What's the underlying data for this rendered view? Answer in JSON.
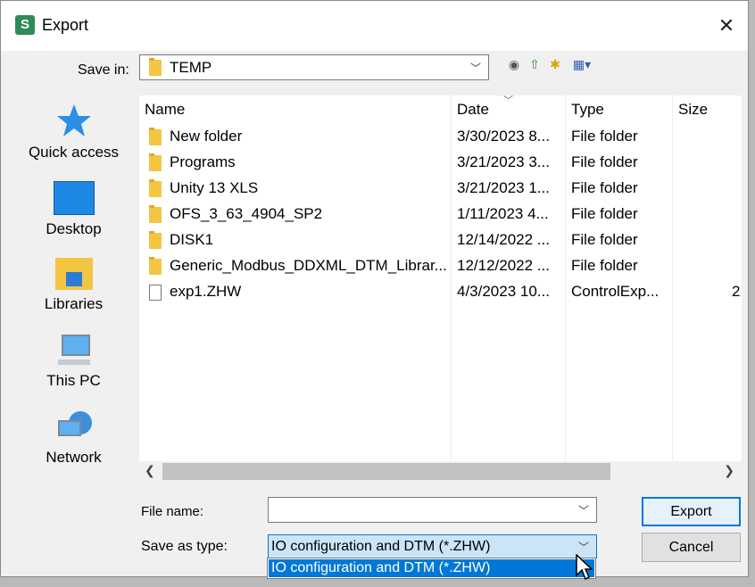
{
  "window": {
    "title": "Export",
    "close_glyph": "✕"
  },
  "save_in": {
    "label": "Save in:",
    "value": "TEMP"
  },
  "places": [
    {
      "label": "Quick access",
      "icon": "star-icon"
    },
    {
      "label": "Desktop",
      "icon": "desktop-icon"
    },
    {
      "label": "Libraries",
      "icon": "libraries-icon"
    },
    {
      "label": "This PC",
      "icon": "computer-icon"
    },
    {
      "label": "Network",
      "icon": "network-icon"
    }
  ],
  "columns": {
    "name": "Name",
    "date": "Date",
    "type": "Type",
    "size": "Size"
  },
  "files": [
    {
      "name": "New folder",
      "date": "3/30/2023 8...",
      "type": "File folder",
      "size": "",
      "kind": "folder"
    },
    {
      "name": "Programs",
      "date": "3/21/2023 3...",
      "type": "File folder",
      "size": "",
      "kind": "folder"
    },
    {
      "name": "Unity 13 XLS",
      "date": "3/21/2023 1...",
      "type": "File folder",
      "size": "",
      "kind": "folder"
    },
    {
      "name": "OFS_3_63_4904_SP2",
      "date": "1/11/2023 4...",
      "type": "File folder",
      "size": "",
      "kind": "folder"
    },
    {
      "name": "DISK1",
      "date": "12/14/2022 ...",
      "type": "File folder",
      "size": "",
      "kind": "folder"
    },
    {
      "name": "Generic_Modbus_DDXML_DTM_Librar...",
      "date": "12/12/2022 ...",
      "type": "File folder",
      "size": "",
      "kind": "folder"
    },
    {
      "name": "exp1.ZHW",
      "date": "4/3/2023 10...",
      "type": "ControlExp...",
      "size": "2",
      "kind": "file"
    }
  ],
  "file_name": {
    "label": "File name:",
    "value": ""
  },
  "save_as_type": {
    "label": "Save as type:",
    "value": "IO configuration and DTM (*.ZHW)",
    "options": [
      "IO configuration and DTM (*.ZHW)"
    ]
  },
  "buttons": {
    "export": "Export",
    "cancel": "Cancel"
  },
  "colors": {
    "accent": "#0078d7",
    "folder": "#f4c542"
  }
}
